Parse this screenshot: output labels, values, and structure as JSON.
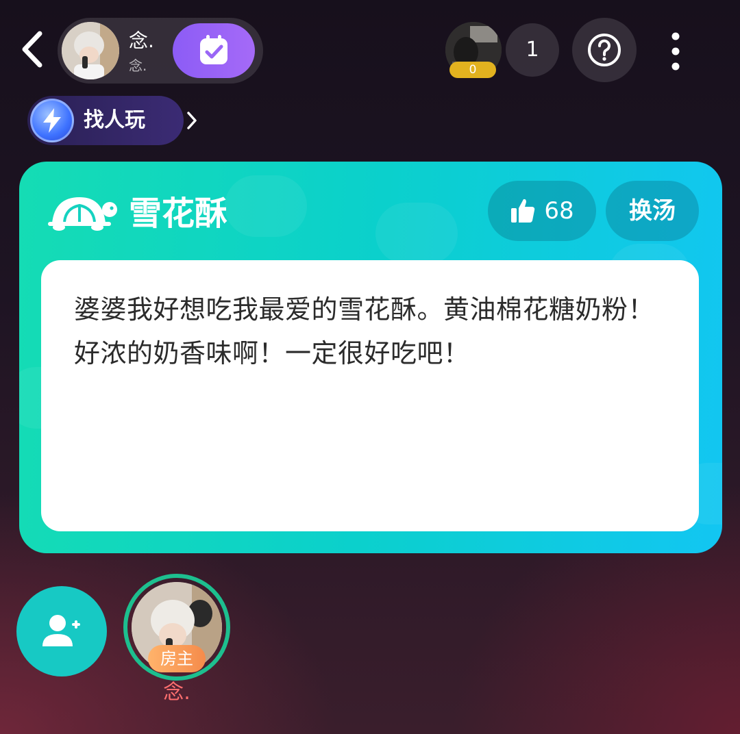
{
  "header": {
    "host_name": "念.",
    "host_id": "念.",
    "audience_badge": "0",
    "audience_count": "1"
  },
  "find_people": {
    "label": "找人玩"
  },
  "card": {
    "title": "雪花酥",
    "likes": "68",
    "swap_label": "换汤",
    "text": "婆婆我好想吃我最爱的雪花酥。黄油棉花糖奶粉！好浓的奶香味啊！一定很好吃吧！"
  },
  "seats": {
    "owner_badge": "房主",
    "host_name": "念."
  },
  "colors": {
    "card_start": "#15dcb4",
    "card_end": "#12c6f2",
    "checkin": "#8c5cf6",
    "owner_badge": "#f58b4b",
    "host_name_seat": "#ff6f6f"
  },
  "icons": [
    "back-icon",
    "checkin-calendar-icon",
    "help-icon",
    "more-icon",
    "lightning-icon",
    "chevron-right-icon",
    "turtle-icon",
    "thumbs-up-icon",
    "add-user-icon"
  ]
}
